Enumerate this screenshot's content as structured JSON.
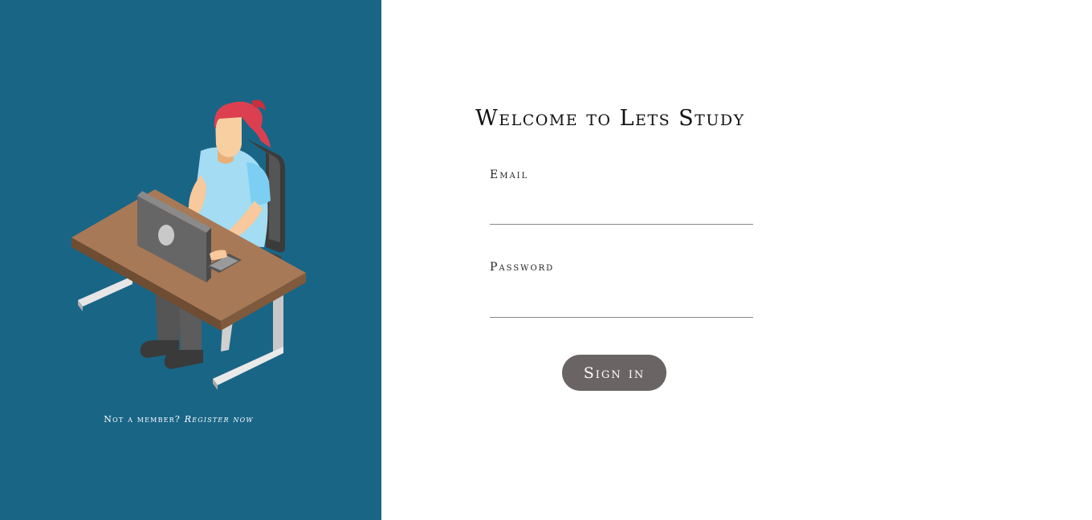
{
  "left_panel": {
    "background_color": "#196586",
    "illustration": "person-at-laptop-desk-illustration",
    "register_prompt": "Not a member?",
    "register_link": "Register now"
  },
  "login": {
    "title": "Welcome to Lets Study",
    "email_label": "Email",
    "email_value": "",
    "password_label": "Password",
    "password_value": "",
    "signin_label": "Sign in",
    "button_color": "#6a6464"
  }
}
